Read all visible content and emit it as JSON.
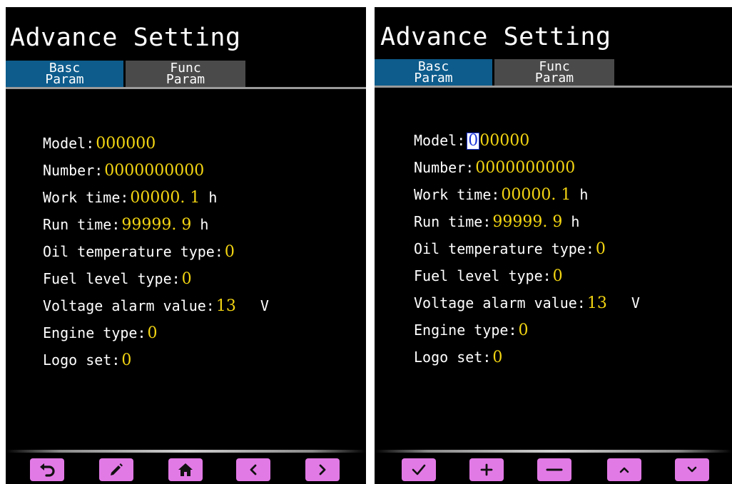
{
  "left_screen": {
    "title": "Advance Setting",
    "tabs": {
      "basc": {
        "line1": "Basc",
        "line2": "Param"
      },
      "func": {
        "line1": "Func",
        "line2": "Param"
      }
    },
    "params": [
      {
        "label": "Model:",
        "value": "000000",
        "unit": ""
      },
      {
        "label": "Number:",
        "value": "0000000000",
        "unit": ""
      },
      {
        "label": "Work time:",
        "value": "00000. 1",
        "unit": "h"
      },
      {
        "label": "Run time:",
        "value": "99999. 9",
        "unit": "h"
      },
      {
        "label": "Oil temperature type:",
        "value": "0",
        "unit": ""
      },
      {
        "label": "Fuel level type:",
        "value": "0",
        "unit": ""
      },
      {
        "label": "Voltage alarm value:",
        "value": "13",
        "unit": "V"
      },
      {
        "label": "Engine type:",
        "value": "0",
        "unit": ""
      },
      {
        "label": "Logo set:",
        "value": "0",
        "unit": ""
      }
    ],
    "buttons": [
      "back-icon",
      "edit-icon",
      "home-icon",
      "chevron-left-icon",
      "chevron-right-icon"
    ]
  },
  "right_screen": {
    "title": "Advance Setting",
    "tabs": {
      "basc": {
        "line1": "Basc",
        "line2": "Param"
      },
      "func": {
        "line1": "Func",
        "line2": "Param"
      }
    },
    "model_cursor_digit": "0",
    "model_rest": "00000",
    "params": [
      {
        "label": "Model:",
        "value": "000000",
        "unit": ""
      },
      {
        "label": "Number:",
        "value": "0000000000",
        "unit": ""
      },
      {
        "label": "Work time:",
        "value": "00000. 1",
        "unit": "h"
      },
      {
        "label": "Run time:",
        "value": "99999. 9",
        "unit": "h"
      },
      {
        "label": "Oil temperature type:",
        "value": "0",
        "unit": ""
      },
      {
        "label": "Fuel level type:",
        "value": "0",
        "unit": ""
      },
      {
        "label": "Voltage alarm value:",
        "value": "13",
        "unit": "V"
      },
      {
        "label": "Engine type:",
        "value": "0",
        "unit": ""
      },
      {
        "label": "Logo set:",
        "value": "0",
        "unit": ""
      }
    ],
    "buttons": [
      "check-icon",
      "plus-icon",
      "minus-icon",
      "chevron-up-icon",
      "chevron-down-icon"
    ]
  },
  "colors": {
    "background": "#000000",
    "value_yellow": "#f3d512",
    "tab_active": "#0d5c8c",
    "tab_inactive": "#4a4a4a",
    "button": "#e27ae6",
    "cursor_blue": "#1a35d8"
  }
}
